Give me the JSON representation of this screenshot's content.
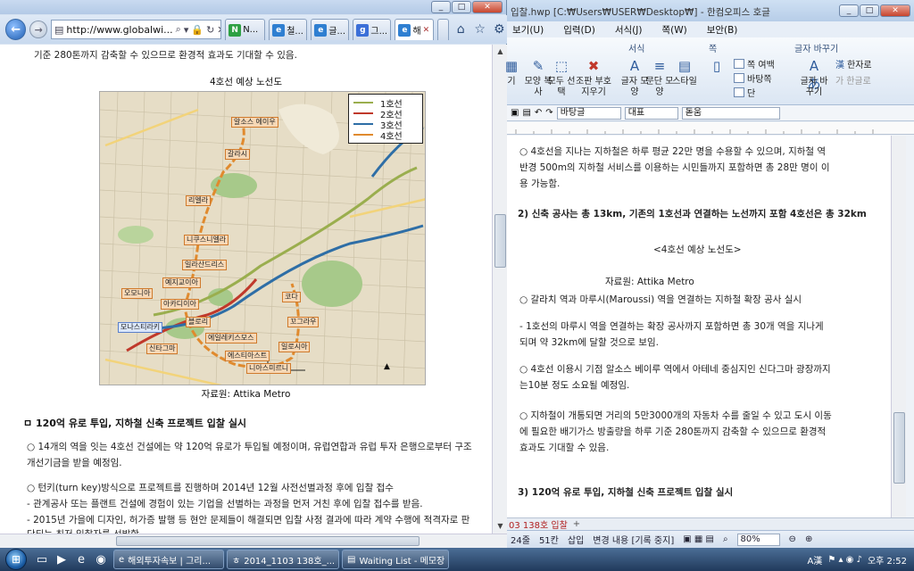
{
  "ie": {
    "address": "http://www.globalwi...",
    "tabs": [
      {
        "label": "N...",
        "favicon": "N",
        "color": "#2ea043"
      },
      {
        "label": "철...",
        "favicon": "e",
        "color": "#2f7fd1"
      },
      {
        "label": "글...",
        "favicon": "e",
        "color": "#2f7fd1"
      },
      {
        "label": "그...",
        "favicon": "g",
        "color": "#3b6fd8"
      },
      {
        "label": "해",
        "favicon": "e",
        "color": "#2f7fd1"
      }
    ],
    "content": {
      "top_line": "기준 280톤까지 감축할 수 있으므로 환경적 효과도 기대할 수 있음.",
      "map_caption": "4호선 예상 노선도",
      "legend": [
        {
          "name": "1호선",
          "color": "#9aae4e"
        },
        {
          "name": "2호선",
          "color": "#c0392b"
        },
        {
          "name": "3호선",
          "color": "#2e6ea6"
        },
        {
          "name": "4호선",
          "color": "#e08a2e"
        }
      ],
      "stations": [
        "알소스 에이우",
        "갈라시",
        "리엘라",
        "니쿠스니엘라",
        "일라산드리스",
        "예지교이아",
        "오모니아",
        "아카디이아",
        "에일레키스모스",
        "모나스티라키",
        "신타그마",
        "코다",
        "꼬그라우",
        "일로시아",
        "니아스미르니",
        "에스티아스트",
        "블로리"
      ],
      "map_source": "자료원: Attika Metro",
      "section_heading": "ㅁ 120억 유로 투입, 지하철 신축 프로젝트 입찰 실시",
      "paragraphs": [
        "○ 14개의 역을 잇는 4호선 건설에는 약 120억 유로가 투입될 예정이며, 유럽연합과 유럽 투자 은행으로부터 구조",
        "   개선기금을 받을 예정임.",
        "○ 턴키(turn key)방식으로 프로젝트를 진행하며 2014년 12월 사전선별과정 후에 입찰 접수",
        " - 관계공사 또는 플랜트 건설에 경험이 있는 기업을 선별하는 과정을 먼저 거친 후에 입찰 접수를 받음.",
        " - 2015년 가을에 디자인, 허가증 발행 등 현안 문제들이 해결되면 입찰 사정 결과에 따라 계약 수행에 적격자로 판",
        "   단되는 최저 입찰자를 선발함"
      ]
    }
  },
  "hwp": {
    "title": "입찰.hwp [C:₩Users₩USER₩Desktop₩] - 한컴오피스 호글",
    "menu": [
      "보기(U)",
      "입력(D)",
      "서식(J)",
      "쪽(W)",
      "보안(B)"
    ],
    "ribbon": {
      "group_labels": [
        "서식",
        "쪽",
        "글자 바꾸기"
      ],
      "buttons": [
        "기",
        "모양 복사",
        "모두 선택",
        "조판 부호 지우기",
        "글자 모양",
        "문단 모양",
        "스타일"
      ],
      "small_buttons": [
        "쪽 여백",
        "바탕쪽",
        "단",
        "한자로",
        "한글로"
      ],
      "big_button": "글자 바꾸기"
    },
    "toolbar": {
      "style": "바탕글",
      "lang": "대표",
      "font": "돋움"
    },
    "lines": [
      "○  4호선을 지나는 지하철은 하루 평균 22만 명을 수용할 수 있으며, 지하철 역",
      "   반경 500m의 지하철 서비스를 이용하는 시민들까지 포함하면 총 28만 명이 이",
      "   용 가능함.",
      "2) 신축 공사는 총 13km, 기존의 1호선과 연결하는 노선까지 포함 4호선은 총 32km",
      "<4호선 예상 노선도>",
      "자료원: Attika Metro",
      "○  갈라치 역과 마루시(Maroussi) 역을 연결하는 지하철 확장 공사 실시",
      "  - 1호선의 마루시 역을 연결하는 확장 공사까지 포함하면 총 30개 역을 지나게",
      "    되며 약 32km에 달할 것으로 보임.",
      "○  4호선 이용시 기점 알소스 베이루 역에서 아테네 중심지인 신다그마 광장까지",
      "   는10분 정도 소요될 예정임.",
      "○  지하철이 개통되면 거리의 5만3000개의 자동차 수를 줄일 수 있고 도시 이동",
      "   에 필요한 배기가스 방출량을 하루 기준 280톤까지 감축할 수 있으므로 환경적",
      "   효과도 기대할 수 있음.",
      "3) 120억 유로 투입, 지하철 신축 프로젝트 입찰 실시"
    ],
    "doc_tab": "03 138호 입찰",
    "status": {
      "line": "24줄",
      "col": "51칸",
      "mode": "삽입",
      "track": "변경 내용 [기록 중지]",
      "zoom": "80%"
    }
  },
  "taskbar": {
    "tasks": [
      "해외투자속보 | 그리...",
      "2014_1103 138호_...",
      "Waiting List - 메모장"
    ],
    "clock": "오후 2:52",
    "ime": "A漢"
  }
}
